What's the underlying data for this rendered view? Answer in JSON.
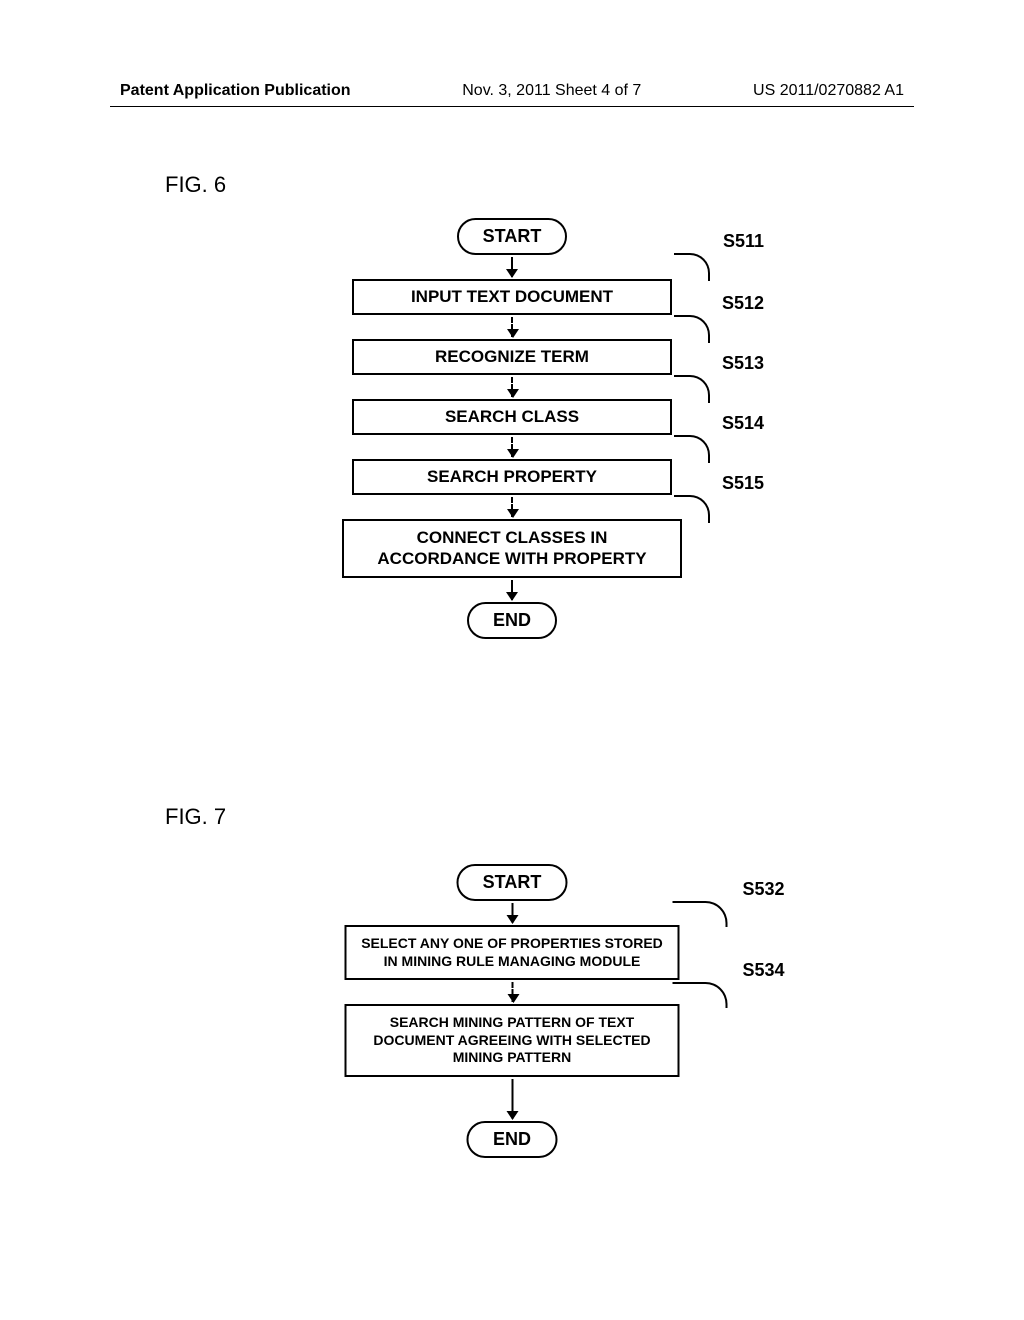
{
  "header": {
    "left": "Patent Application Publication",
    "center": "Nov. 3, 2011   Sheet 4 of 7",
    "right": "US 2011/0270882 A1"
  },
  "fig6": {
    "label": "FIG. 6",
    "start": "START",
    "end": "END",
    "steps": [
      {
        "id": "S511",
        "text": "INPUT TEXT DOCUMENT"
      },
      {
        "id": "S512",
        "text": "RECOGNIZE TERM"
      },
      {
        "id": "S513",
        "text": "SEARCH CLASS"
      },
      {
        "id": "S514",
        "text": "SEARCH PROPERTY"
      },
      {
        "id": "S515",
        "text": "CONNECT CLASSES IN ACCORDANCE WITH PROPERTY"
      }
    ]
  },
  "fig7": {
    "label": "FIG. 7",
    "start": "START",
    "end": "END",
    "steps": [
      {
        "id": "S532",
        "text": "SELECT ANY ONE OF PROPERTIES STORED IN MINING RULE MANAGING MODULE"
      },
      {
        "id": "S534",
        "text": "SEARCH MINING PATTERN OF TEXT DOCUMENT AGREEING WITH SELECTED MINING PATTERN"
      }
    ]
  }
}
